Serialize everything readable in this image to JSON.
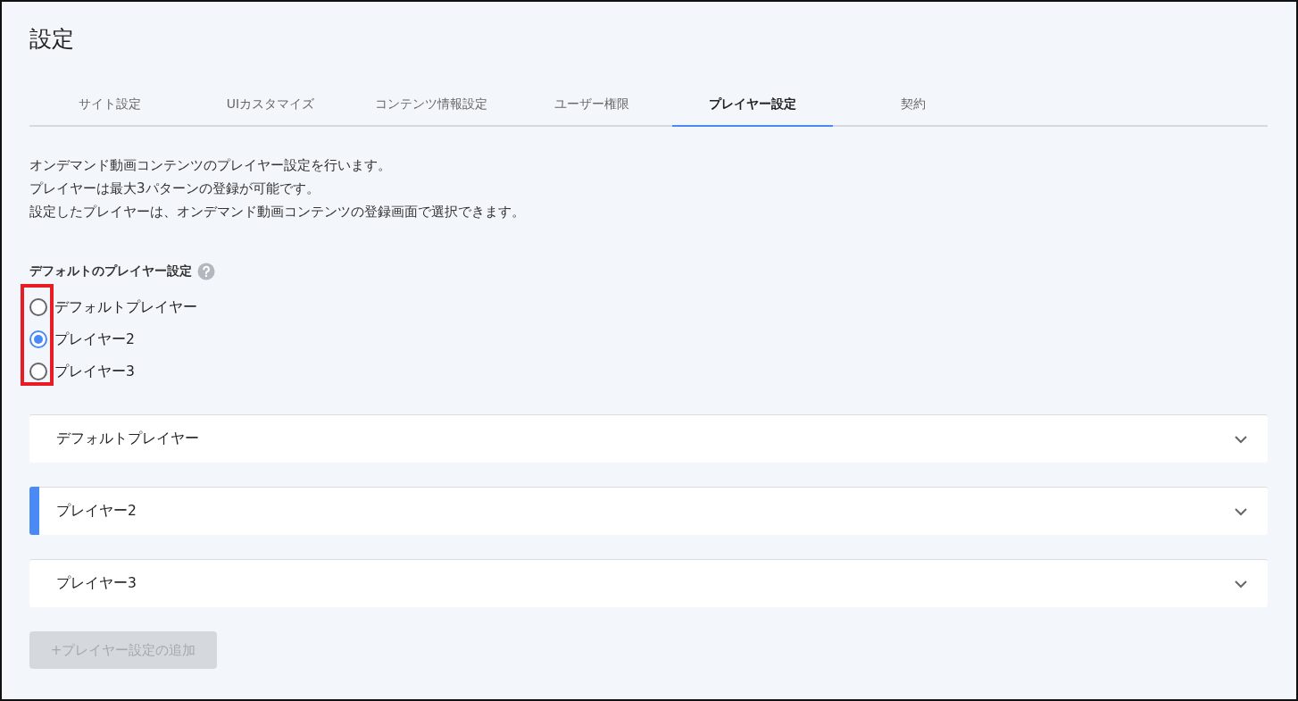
{
  "page": {
    "title": "設定"
  },
  "tabs": [
    {
      "label": "サイト設定",
      "selected": false
    },
    {
      "label": "UIカスタマイズ",
      "selected": false
    },
    {
      "label": "コンテンツ情報設定",
      "selected": false
    },
    {
      "label": "ユーザー権限",
      "selected": false
    },
    {
      "label": "プレイヤー設定",
      "selected": true
    },
    {
      "label": "契約",
      "selected": false
    }
  ],
  "description": [
    "オンデマンド動画コンテンツのプレイヤー設定を行います。",
    "プレイヤーは最大3パターンの登録が可能です。",
    "設定したプレイヤーは、オンデマンド動画コンテンツの登録画面で選択できます。"
  ],
  "default_player": {
    "label": "デフォルトのプレイヤー設定",
    "highlighted": true,
    "options": [
      {
        "label": "デフォルトプレイヤー",
        "selected": false
      },
      {
        "label": "プレイヤー2",
        "selected": true
      },
      {
        "label": "プレイヤー3",
        "selected": false
      }
    ]
  },
  "panels": [
    {
      "title": "デフォルトプレイヤー",
      "selected": false,
      "expanded": false
    },
    {
      "title": "プレイヤー2",
      "selected": true,
      "expanded": false
    },
    {
      "title": "プレイヤー3",
      "selected": false,
      "expanded": false
    }
  ],
  "add_button": {
    "label": "+プレイヤー設定の追加",
    "disabled": true
  }
}
